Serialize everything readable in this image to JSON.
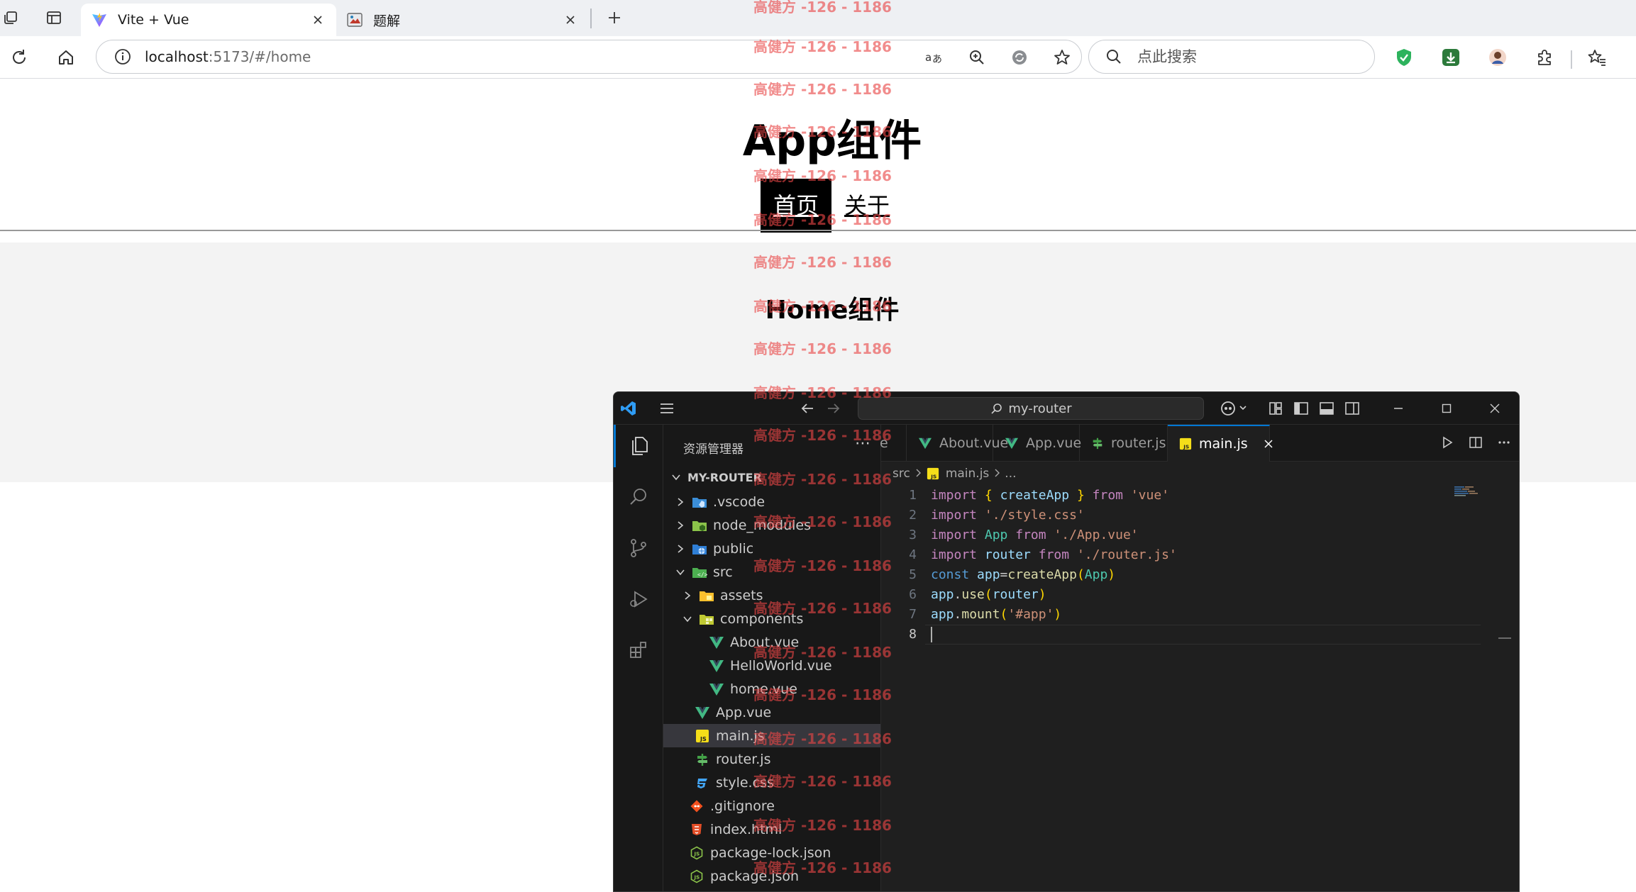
{
  "browser": {
    "tabs": [
      {
        "title": "Vite + Vue",
        "active": true
      },
      {
        "title": "题解",
        "active": false
      }
    ],
    "address": {
      "host": "localhost",
      "rest": ":5173/#/home"
    },
    "search_placeholder": "点此搜索"
  },
  "page": {
    "app_title": "App组件",
    "nav": [
      {
        "label": "首页",
        "active": true
      },
      {
        "label": "关于",
        "active": false
      }
    ],
    "home_title": "Home组件"
  },
  "vscode": {
    "command_center": "my-router",
    "explorer_title": "资源管理器",
    "root_folder": "MY-ROUTER",
    "tree": [
      {
        "label": ".vscode"
      },
      {
        "label": "node_modules"
      },
      {
        "label": "public"
      },
      {
        "label": "src"
      },
      {
        "label": "assets"
      },
      {
        "label": "components"
      },
      {
        "label": "About.vue"
      },
      {
        "label": "HelloWorld.vue"
      },
      {
        "label": "home.vue"
      },
      {
        "label": "App.vue"
      },
      {
        "label": "main.js"
      },
      {
        "label": "router.js"
      },
      {
        "label": "style.css"
      },
      {
        "label": ".gitignore"
      },
      {
        "label": "index.html"
      },
      {
        "label": "package-lock.json"
      },
      {
        "label": "package.json"
      }
    ],
    "editor_tabs": [
      {
        "label": "e"
      },
      {
        "label": "About.vue"
      },
      {
        "label": "App.vue"
      },
      {
        "label": "router.js"
      },
      {
        "label": "main.js"
      }
    ],
    "breadcrumb": {
      "folder": "src",
      "file": "main.js",
      "tail": "..."
    },
    "code_lines": [
      "import { createApp } from 'vue'",
      "import './style.css'",
      "import App from './App.vue'",
      "import router from './router.js'",
      "const app=createApp(App)",
      "app.use(router)",
      "app.mount('#app')",
      ""
    ],
    "line_numbers": [
      "1",
      "2",
      "3",
      "4",
      "5",
      "6",
      "7",
      "8"
    ]
  },
  "watermark": {
    "text": "高健方 -126 - 1186"
  },
  "colors": {
    "accent": "#0078d4",
    "vue_green": "#42b883",
    "js_yellow": "#f5de19",
    "watermark": "#e84646"
  }
}
